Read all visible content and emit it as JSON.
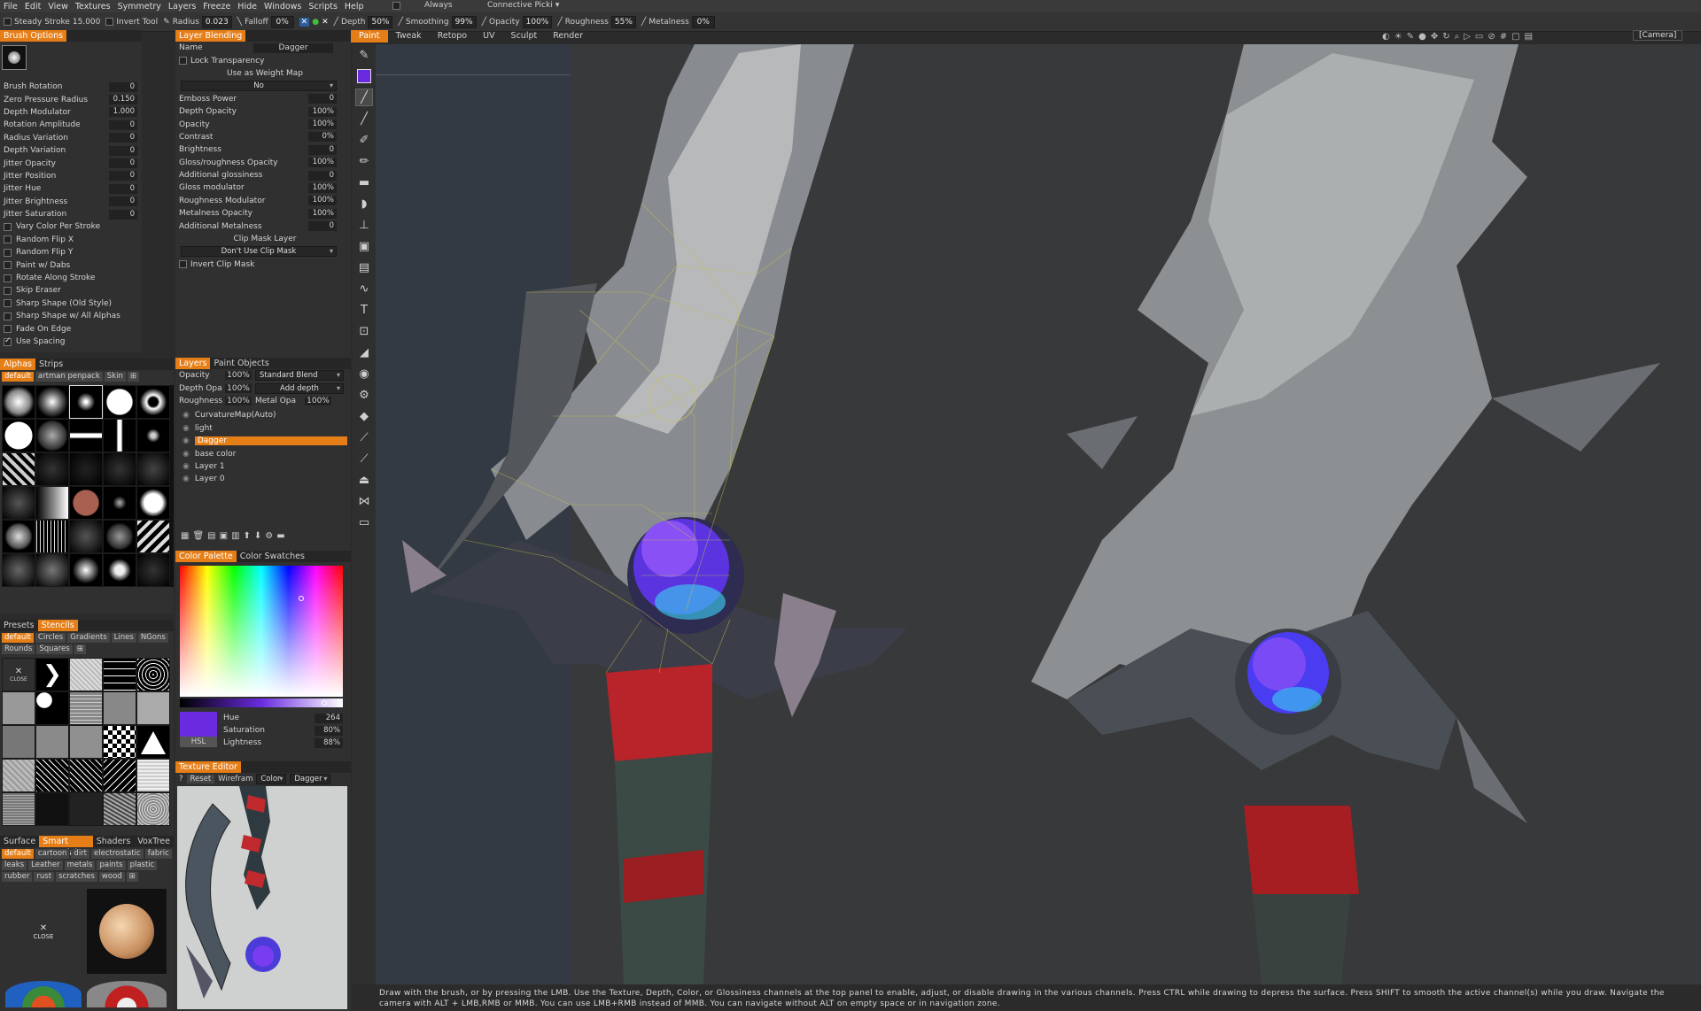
{
  "menu": [
    "File",
    "Edit",
    "View",
    "Textures",
    "Symmetry",
    "Layers",
    "Freeze",
    "Hide",
    "Windows",
    "Scripts",
    "Help"
  ],
  "toolbar": {
    "steady_stroke_label": "Steady Stroke",
    "steady_stroke_value": "15.000",
    "invert_tool_label": "Invert Tool",
    "radius_label": "Radius",
    "radius_value": "0.023",
    "falloff_label": "Falloff",
    "falloff_value": "0%",
    "always_label": "Always",
    "connective_label": "Connective Picki",
    "depth_label": "Depth",
    "depth_value": "50%",
    "smoothing_label": "Smoothing",
    "smoothing_value": "99%",
    "opacity_label": "Opacity",
    "opacity_value": "100%",
    "roughness_label": "Roughness",
    "roughness_value": "55%",
    "metalness_label": "Metalness",
    "metalness_value": "0%"
  },
  "room_tabs": [
    "Paint",
    "Tweak",
    "Retopo",
    "UV",
    "Sculpt",
    "Render"
  ],
  "camera_label": "[Camera]",
  "brush_options": {
    "title": "Brush Options",
    "params": [
      {
        "label": "Brush Rotation",
        "value": "0"
      },
      {
        "label": "Zero Pressure Radius",
        "value": "0.150"
      },
      {
        "label": "Depth Modulator",
        "value": "1.000"
      },
      {
        "label": "Rotation Amplitude",
        "value": "0"
      },
      {
        "label": "Radius Variation",
        "value": "0"
      },
      {
        "label": "Depth Variation",
        "value": "0"
      },
      {
        "label": "Jitter Opacity",
        "value": "0"
      },
      {
        "label": "Jitter Position",
        "value": "0"
      },
      {
        "label": "Jitter Hue",
        "value": "0"
      },
      {
        "label": "Jitter Brightness",
        "value": "0"
      },
      {
        "label": "Jitter Saturation",
        "value": "0"
      }
    ],
    "checks": [
      {
        "label": "Vary Color Per Stroke",
        "on": false
      },
      {
        "label": "Random Flip X",
        "on": false
      },
      {
        "label": "Random Flip Y",
        "on": false
      },
      {
        "label": "Paint w/ Dabs",
        "on": false
      },
      {
        "label": "Rotate Along Stroke",
        "on": false
      },
      {
        "label": "Skip Eraser",
        "on": false
      },
      {
        "label": "Sharp Shape (Old Style)",
        "on": false
      },
      {
        "label": "Sharp Shape w/ All Alphas",
        "on": false
      },
      {
        "label": "Fade On Edge",
        "on": false
      },
      {
        "label": "Use Spacing",
        "on": true
      }
    ]
  },
  "layer_blending": {
    "title": "Layer Blending",
    "name_label": "Name",
    "name_value": "Dagger",
    "lock_transparency": "Lock Transparency",
    "weight_map": "Use as Weight Map",
    "weight_map_value": "No",
    "params": [
      {
        "label": "Emboss Power",
        "value": "0"
      },
      {
        "label": "Depth Opacity",
        "value": "100%"
      },
      {
        "label": "Opacity",
        "value": "100%"
      },
      {
        "label": "Contrast",
        "value": "0%"
      },
      {
        "label": "Brightness",
        "value": "0"
      },
      {
        "label": "Gloss/roughness Opacity",
        "value": "100%"
      },
      {
        "label": "Additional glossiness",
        "value": "0"
      },
      {
        "label": "Gloss modulator",
        "value": "100%"
      },
      {
        "label": "Roughness Modulator",
        "value": "100%"
      },
      {
        "label": "Metalness Opacity",
        "value": "100%"
      },
      {
        "label": "Additional Metalness",
        "value": "0"
      }
    ],
    "clip_mask_layer": "Clip Mask Layer",
    "clip_mask_value": "Don't Use Clip Mask",
    "invert_clip_mask": "Invert Clip Mask"
  },
  "layers_panel": {
    "tabs": [
      "Layers",
      "Paint Objects"
    ],
    "opacity_label": "Opacity",
    "opacity_value": "100%",
    "blend_value": "Standard Blend",
    "depth_label": "Depth Opa",
    "depth_value": "100%",
    "depth_mode": "Add depth",
    "rough_label": "Roughness",
    "rough_value": "100%",
    "metal_label": "Metal Opa",
    "metal_value": "100%",
    "items": [
      {
        "name": "CurvatureMap(Auto)",
        "selected": false
      },
      {
        "name": "light",
        "selected": false
      },
      {
        "name": "Dagger",
        "selected": true
      },
      {
        "name": "base color",
        "selected": false
      },
      {
        "name": "Layer 1",
        "selected": false
      },
      {
        "name": "Layer 0",
        "selected": false
      }
    ]
  },
  "alphas_panel": {
    "tabs": [
      "Alphas",
      "Strips"
    ],
    "subtabs": [
      "default",
      "artman penpack",
      "Skin"
    ]
  },
  "stencils_panel": {
    "tabs": [
      "Presets",
      "Stencils"
    ],
    "subtabs": [
      "default",
      "Circles",
      "Gradients",
      "Lines",
      "NGons",
      "Rounds",
      "Squares"
    ],
    "close_label": "CLOSE"
  },
  "smart_materials_panel": {
    "tabs": [
      "Surface",
      "Smart Materials",
      "Shaders",
      "VoxTree"
    ],
    "subtabs": [
      "default",
      "cartoon",
      "dirt",
      "electrostatic",
      "fabric",
      "leaks",
      "Leather",
      "metals",
      "paints",
      "plastic",
      "rubber",
      "rust",
      "scratches",
      "wood"
    ],
    "close_label": "CLOSE"
  },
  "color_palette": {
    "tabs": [
      "Color Palette",
      "Color Swatches"
    ],
    "hue_label": "Hue",
    "hue_value": "264",
    "saturation_label": "Saturation",
    "saturation_value": "80%",
    "lightness_label": "Lightness",
    "lightness_value": "88%",
    "mode": "HSL",
    "current_color": "#6a2be0"
  },
  "texture_editor": {
    "title": "Texture Editor",
    "help": "?",
    "reset": "Reset",
    "wireframe": "Wirefram",
    "channel": "Color",
    "object": "Dagger"
  },
  "status_text": "Draw with the brush, or by pressing the LMB. Use the Texture, Depth, Color, or Glossiness channels at the top panel to enable, adjust, or disable drawing in the various channels. Press CTRL while drawing to depress the surface. Press SHIFT to smooth the active channel(s) while you draw. Navigate the camera with ALT + LMB,RMB or MMB. You can use LMB+RMB instead of MMB. You can navigate without ALT on empty space or in navigation zone.",
  "colors": {
    "accent": "#e67e18",
    "panel": "#303030",
    "gem": "#6a2be0"
  }
}
